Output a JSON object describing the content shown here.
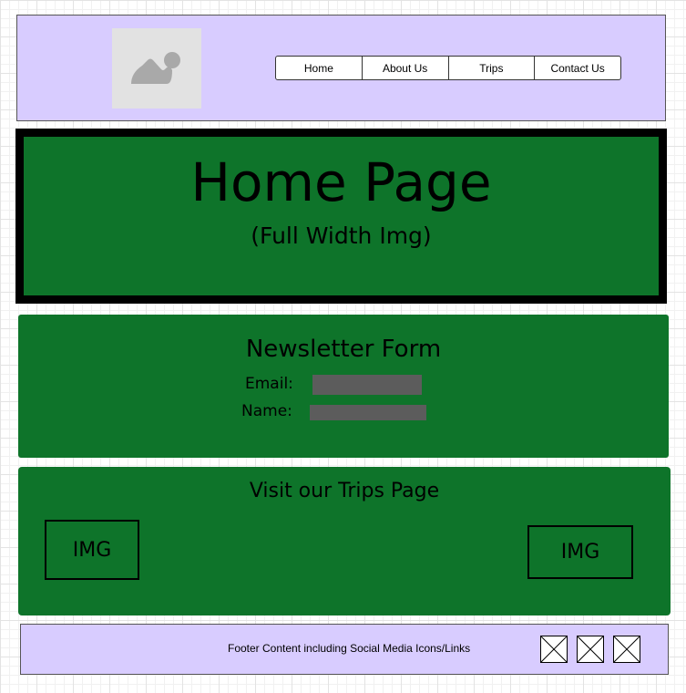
{
  "header": {
    "logo": "image-placeholder-icon",
    "nav": [
      "Home",
      "About Us",
      "Trips",
      "Contact Us"
    ]
  },
  "hero": {
    "title": "Home Page",
    "subtitle": "(Full Width Img)"
  },
  "newsletter": {
    "title": "Newsletter Form",
    "email_label": "Email:",
    "name_label": "Name:",
    "email_value": "",
    "name_value": ""
  },
  "trips": {
    "title": "Visit our Trips Page",
    "img_left": "IMG",
    "img_right": "IMG"
  },
  "footer": {
    "text": "Footer Content including Social Media Icons/Links",
    "social_icons": [
      "social-placeholder-icon",
      "social-placeholder-icon",
      "social-placeholder-icon"
    ]
  },
  "colors": {
    "header_bg": "#d8ccff",
    "section_green": "#0e742a",
    "input_gray": "#5c5c5c"
  }
}
